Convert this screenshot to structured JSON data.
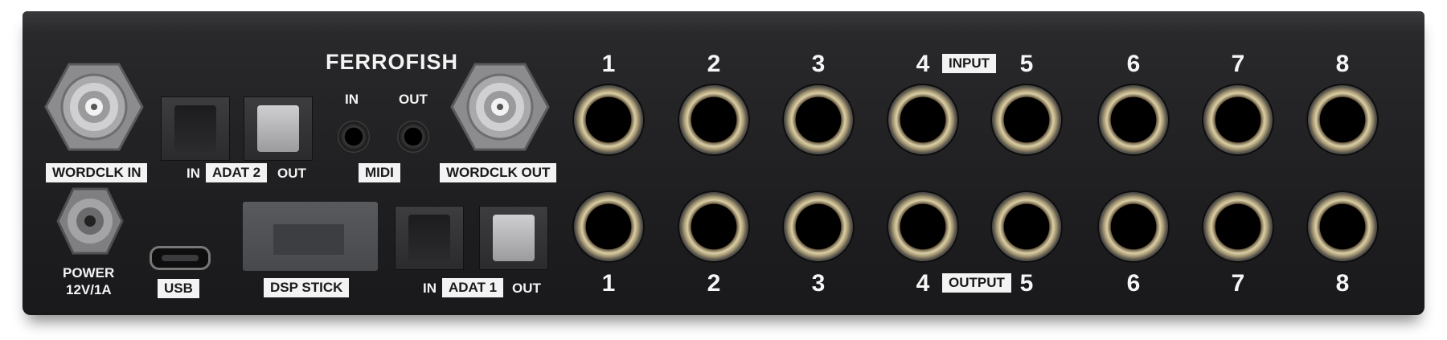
{
  "brand": "FERROFISH",
  "left_panel": {
    "wordclk_in": "WORDCLK IN",
    "wordclk_out": "WORDCLK OUT",
    "adat2": {
      "in": "IN",
      "label": "ADAT 2",
      "out": "OUT"
    },
    "midi": {
      "in": "IN",
      "out": "OUT",
      "label": "MIDI"
    },
    "power": {
      "line1": "POWER",
      "line2": "12V/1A"
    },
    "usb": "USB",
    "dsp_stick": "DSP STICK",
    "adat1": {
      "in": "IN",
      "label": "ADAT 1",
      "out": "OUT"
    }
  },
  "inputs": {
    "label": "INPUT",
    "numbers": [
      "1",
      "2",
      "3",
      "4",
      "5",
      "6",
      "7",
      "8"
    ]
  },
  "outputs": {
    "label": "OUTPUT",
    "numbers": [
      "1",
      "2",
      "3",
      "4",
      "5",
      "6",
      "7",
      "8"
    ]
  },
  "colors": {
    "chassis": "#1f1f21",
    "label_bg": "#f3f3f3",
    "jack_ring": "#d9cfa8"
  }
}
